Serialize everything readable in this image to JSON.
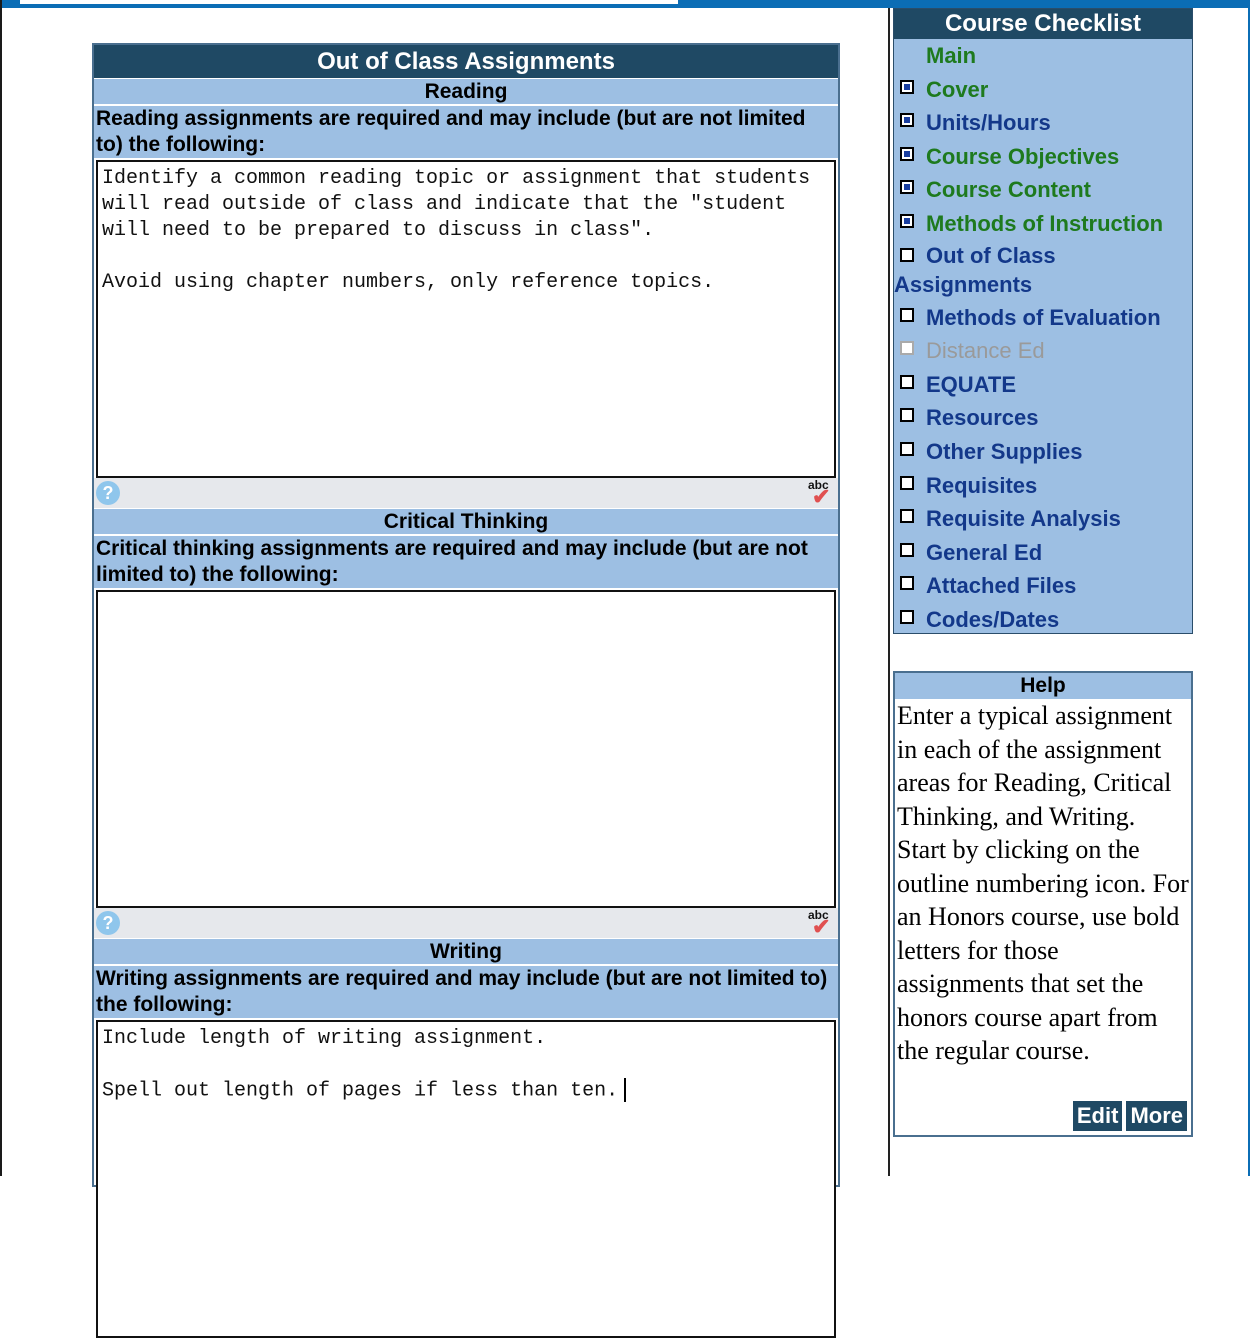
{
  "main": {
    "title": "Out of Class Assignments",
    "sections": [
      {
        "heading": "Reading",
        "description": "Reading assignments are required and may include (but are not limited to) the following:",
        "text": "Identify a common reading topic or assignment that students\nwill read outside of class and indicate that the \"student\nwill need to be prepared to discuss in class\".\n\nAvoid using chapter numbers, only reference topics."
      },
      {
        "heading": "Critical Thinking",
        "description": "Critical thinking assignments are required and may include (but are not limited to) the following:",
        "text": ""
      },
      {
        "heading": "Writing",
        "description": "Writing assignments are required and may include (but are not limited to) the following:",
        "text": "Include length of writing assignment.\n\nSpell out length of pages if less than ten."
      }
    ],
    "help_glyph": "?",
    "spell_abc": "abc",
    "spell_check": "✔"
  },
  "checklist": {
    "title": "Course Checklist",
    "items": [
      {
        "label": "Main",
        "state": "none",
        "color": "green"
      },
      {
        "label": "Cover",
        "state": "checked",
        "color": "green"
      },
      {
        "label": "Units/Hours",
        "state": "checked",
        "color": "blue"
      },
      {
        "label": "Course Objectives",
        "state": "checked",
        "color": "green"
      },
      {
        "label": "Course Content",
        "state": "checked",
        "color": "green"
      },
      {
        "label": "Methods of Instruction",
        "state": "checked",
        "color": "green"
      },
      {
        "label": "Out of Class Assignments",
        "state": "unchecked",
        "color": "blue"
      },
      {
        "label": "Methods of Evaluation",
        "state": "unchecked",
        "color": "blue"
      },
      {
        "label": "Distance Ed",
        "state": "disabled",
        "color": "gray"
      },
      {
        "label": "EQUATE",
        "state": "unchecked",
        "color": "blue"
      },
      {
        "label": "Resources",
        "state": "unchecked",
        "color": "blue"
      },
      {
        "label": "Other Supplies",
        "state": "unchecked",
        "color": "blue"
      },
      {
        "label": "Requisites",
        "state": "unchecked",
        "color": "blue"
      },
      {
        "label": "Requisite Analysis",
        "state": "unchecked",
        "color": "blue"
      },
      {
        "label": "General Ed",
        "state": "unchecked",
        "color": "blue"
      },
      {
        "label": "Attached Files",
        "state": "unchecked",
        "color": "blue"
      },
      {
        "label": "Codes/Dates",
        "state": "unchecked",
        "color": "blue"
      }
    ]
  },
  "help": {
    "title": "Help",
    "text": "Enter a typical assignment in each of the assignment areas for Reading, Critical Thinking, and Writing. Start by clicking on the outline numbering icon. For an Honors course, use bold letters for those assignments that set the honors course apart from the regular course.",
    "edit_label": "Edit",
    "more_label": "More"
  },
  "colors": {
    "header_dark": "#1f4964",
    "panel_light": "#9dbfe3",
    "top_bar": "#0b6db5",
    "green_link": "#1e7a1e",
    "blue_link": "#13388a"
  }
}
